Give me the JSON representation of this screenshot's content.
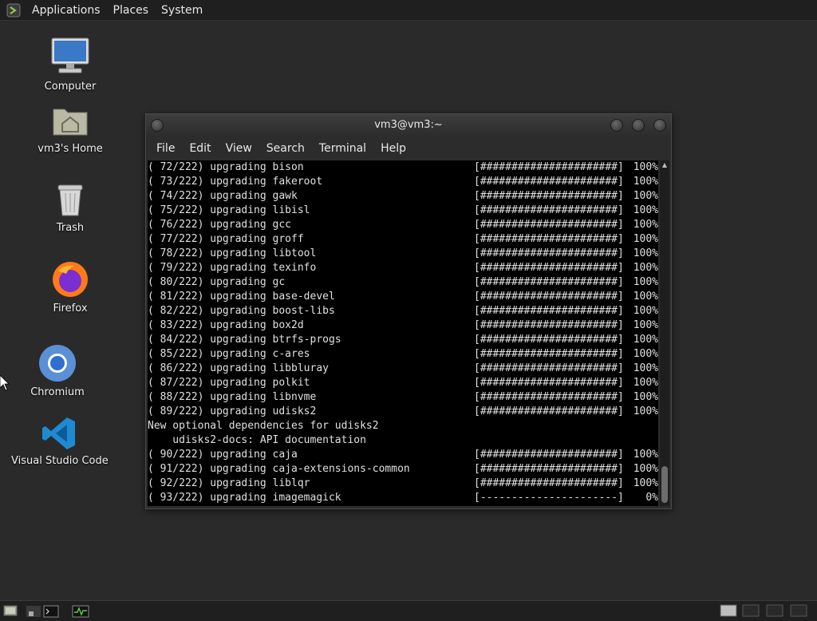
{
  "top_panel": {
    "menus": [
      "Applications",
      "Places",
      "System"
    ]
  },
  "desktop": {
    "icons": [
      {
        "label": "Computer"
      },
      {
        "label": "vm3's Home"
      },
      {
        "label": "Trash"
      },
      {
        "label": "Firefox"
      },
      {
        "label": "Chromium"
      },
      {
        "label": "Visual Studio Code"
      }
    ]
  },
  "terminal": {
    "title": "vm3@vm3:~",
    "menu": [
      "File",
      "Edit",
      "View",
      "Search",
      "Terminal",
      "Help"
    ],
    "lines": [
      {
        "text": "( 72/222) upgrading bison",
        "bar": "[######################]",
        "pct": "100%"
      },
      {
        "text": "( 73/222) upgrading fakeroot",
        "bar": "[######################]",
        "pct": "100%"
      },
      {
        "text": "( 74/222) upgrading gawk",
        "bar": "[######################]",
        "pct": "100%"
      },
      {
        "text": "( 75/222) upgrading libisl",
        "bar": "[######################]",
        "pct": "100%"
      },
      {
        "text": "( 76/222) upgrading gcc",
        "bar": "[######################]",
        "pct": "100%"
      },
      {
        "text": "( 77/222) upgrading groff",
        "bar": "[######################]",
        "pct": "100%"
      },
      {
        "text": "( 78/222) upgrading libtool",
        "bar": "[######################]",
        "pct": "100%"
      },
      {
        "text": "( 79/222) upgrading texinfo",
        "bar": "[######################]",
        "pct": "100%"
      },
      {
        "text": "( 80/222) upgrading gc",
        "bar": "[######################]",
        "pct": "100%"
      },
      {
        "text": "( 81/222) upgrading base-devel",
        "bar": "[######################]",
        "pct": "100%"
      },
      {
        "text": "( 82/222) upgrading boost-libs",
        "bar": "[######################]",
        "pct": "100%"
      },
      {
        "text": "( 83/222) upgrading box2d",
        "bar": "[######################]",
        "pct": "100%"
      },
      {
        "text": "( 84/222) upgrading btrfs-progs",
        "bar": "[######################]",
        "pct": "100%"
      },
      {
        "text": "( 85/222) upgrading c-ares",
        "bar": "[######################]",
        "pct": "100%"
      },
      {
        "text": "( 86/222) upgrading libbluray",
        "bar": "[######################]",
        "pct": "100%"
      },
      {
        "text": "( 87/222) upgrading polkit",
        "bar": "[######################]",
        "pct": "100%"
      },
      {
        "text": "( 88/222) upgrading libnvme",
        "bar": "[######################]",
        "pct": "100%"
      },
      {
        "text": "( 89/222) upgrading udisks2",
        "bar": "[######################]",
        "pct": "100%"
      },
      {
        "text": "New optional dependencies for udisks2",
        "bar": "",
        "pct": ""
      },
      {
        "text": "    udisks2-docs: API documentation",
        "bar": "",
        "pct": ""
      },
      {
        "text": "( 90/222) upgrading caja",
        "bar": "[######################]",
        "pct": "100%"
      },
      {
        "text": "( 91/222) upgrading caja-extensions-common",
        "bar": "[######################]",
        "pct": "100%"
      },
      {
        "text": "( 92/222) upgrading liblqr",
        "bar": "[######################]",
        "pct": "100%"
      },
      {
        "text": "( 93/222) upgrading imagemagick",
        "bar": "[----------------------]",
        "pct": "0%"
      }
    ]
  },
  "colors": {
    "desktop_bg": "#2a2a2a",
    "panel_bg": "#1f1f1f",
    "terminal_bg": "#000000",
    "terminal_fg": "#e0e0e0"
  }
}
